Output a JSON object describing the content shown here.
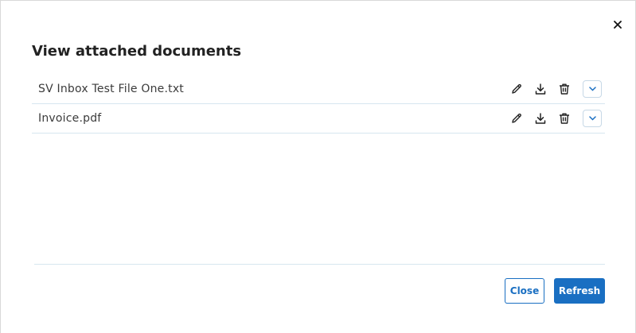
{
  "dialog": {
    "title": "View attached documents",
    "close_icon": "close-icon"
  },
  "documents": [
    {
      "name": "SV Inbox Test File One.txt"
    },
    {
      "name": "Invoice.pdf"
    }
  ],
  "row_action_icons": [
    "edit-icon",
    "download-icon",
    "delete-icon",
    "chevron-down-icon"
  ],
  "footer": {
    "close_label": "Close",
    "refresh_label": "Refresh"
  },
  "colors": {
    "accent": "#1a6fc2",
    "divider": "#d6e6ef",
    "text": "#3b3b3b",
    "title": "#222222"
  }
}
